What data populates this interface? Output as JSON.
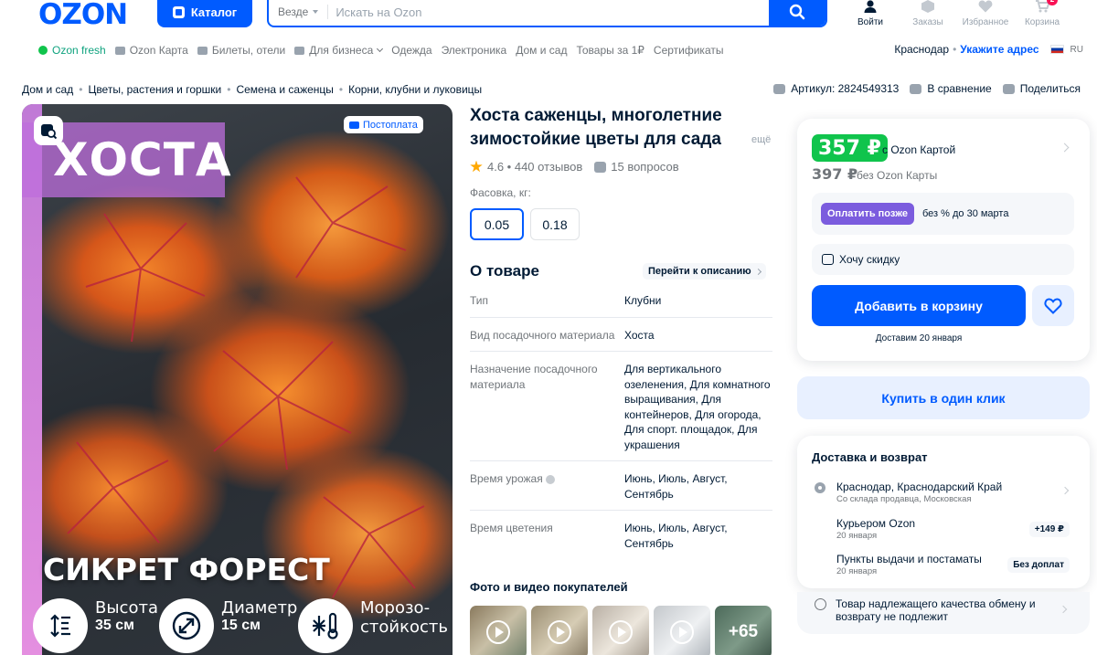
{
  "header": {
    "logo": "OZON",
    "catalog_label": "Каталог",
    "search_scope": "Везде",
    "search_placeholder": "Искать на Ozon",
    "actions": [
      {
        "label": "Войти"
      },
      {
        "label": "Заказы"
      },
      {
        "label": "Избранное"
      },
      {
        "label": "Корзина",
        "badge": "2"
      }
    ]
  },
  "nav": {
    "items": [
      "Ozon fresh",
      "Ozon Карта",
      "Билеты, отели",
      "Для бизнеса",
      "Одежда",
      "Электроника",
      "Дом и сад",
      "Товары за 1₽",
      "Сертификаты"
    ],
    "city": "Краснодар",
    "address_link": "Укажите адрес",
    "lang": "RU"
  },
  "breadcrumbs": [
    "Дом и сад",
    "Цветы, растения и горшки",
    "Семена и саженцы",
    "Корни, клубни и луковицы"
  ],
  "meta": {
    "article": "Артикул: 2824549313",
    "compare": "В сравнение",
    "share": "Поделиться"
  },
  "gallery": {
    "badge": "Постоплата",
    "image_title": "ХОСТА",
    "image_subtitle": "СИКРЕТ ФОРЕСТ",
    "specs": [
      {
        "label": "Высота",
        "value": "35 см"
      },
      {
        "label": "Диаметр",
        "value": "15 см"
      },
      {
        "label": "Морозо-",
        "value": "стойкость"
      }
    ]
  },
  "product": {
    "title": "Хоста саженцы, многолетние зимостойкие цветы для сада",
    "more": "ещё",
    "rating": "4.6 • 440 отзывов",
    "questions": "15 вопросов",
    "pack_label": "Фасовка, кг:",
    "packs": [
      "0.05",
      "0.18"
    ],
    "about_title": "О товаре",
    "go_to_description": "Перейти к описанию",
    "specs": [
      {
        "k": "Тип",
        "v": "Клубни"
      },
      {
        "k": "Вид посадочного материала",
        "v": "Хоста"
      },
      {
        "k": "Назначение посадочного материала",
        "v": "Для вертикального озеленения, Для комнатного выращивания, Для контейнеров, Для огорода, Для спорт. площадок, Для украшения"
      },
      {
        "k": "Время урожая",
        "v": "Июнь, Июль, Август, Сентябрь"
      },
      {
        "k": "Время цветения",
        "v": "Июнь, Июль, Август, Сентябрь"
      }
    ],
    "photos_title": "Фото и видео покупателей",
    "photos_more": "+65"
  },
  "price": {
    "card_price": "357 ₽",
    "card_label": "с Ozon Картой",
    "regular_price": "397 ₽",
    "regular_label": "без Ozon Карты",
    "pay_later": "Оплатить позже",
    "pay_later_text": "без % до 30 марта",
    "want_discount": "Хочу скидку",
    "add_to_cart": "Добавить в корзину",
    "delivery_note": "Доставим 20 января",
    "one_click": "Купить в один клик"
  },
  "delivery": {
    "title": "Доставка и возврат",
    "rows": [
      {
        "title": "Краснодар, Краснодарский Край",
        "sub": "Со склада продавца, Московская"
      },
      {
        "title": "Курьером Ozon",
        "sub": "20 января",
        "tag": "+149 ₽"
      },
      {
        "title": "Пункты выдачи и постаматы",
        "sub": "20 января",
        "tag": "Без доплат"
      }
    ],
    "returns": "Товар надлежащего качества обмену и возврату не подлежит"
  },
  "colors": {
    "brand": "#005bff",
    "price_green": "#10c44c",
    "pay_later": "#7b5cde"
  }
}
